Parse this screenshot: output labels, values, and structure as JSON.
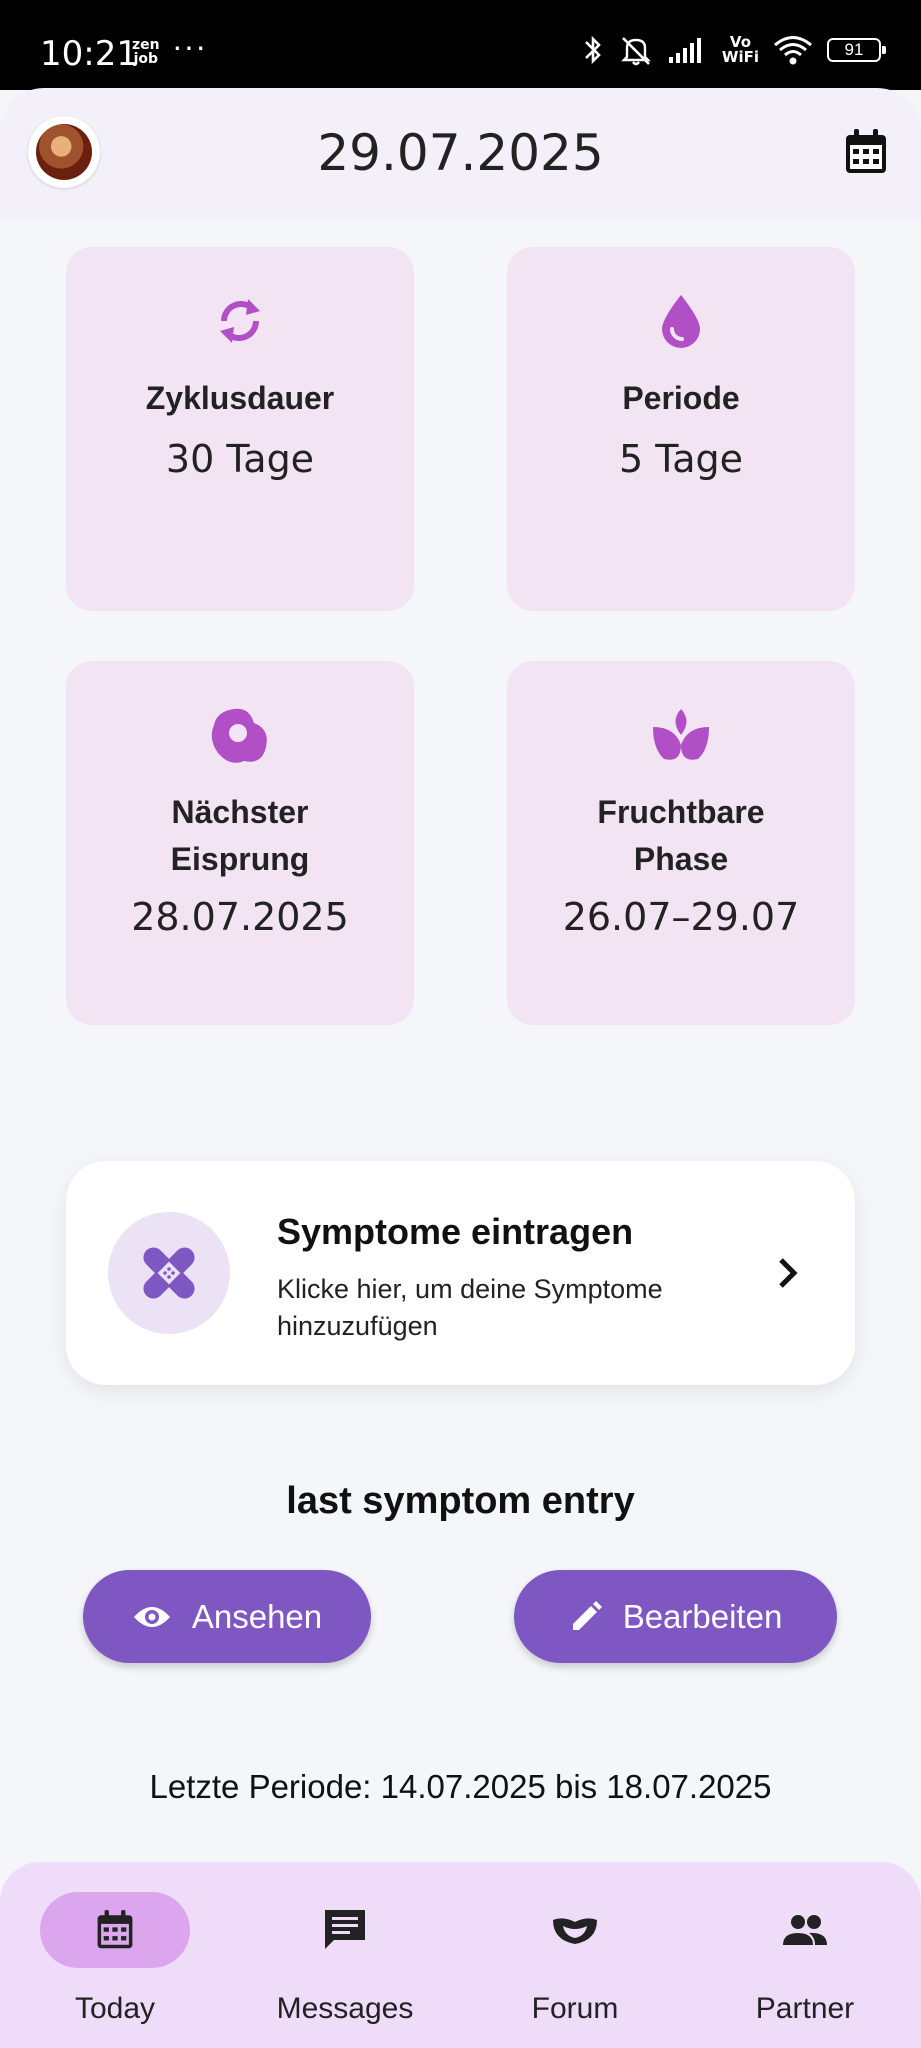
{
  "status_bar": {
    "time": "10:21",
    "app_badge_top": "zen",
    "app_badge_bottom": "job",
    "more": "···",
    "vowifi_top": "Vo",
    "vowifi_bottom": "WiFi",
    "battery": "91"
  },
  "header": {
    "date": "29.07.2025",
    "avatar_icon": "avatar-image",
    "calendar_icon": "calendar-icon"
  },
  "stats": [
    {
      "icon": "cycle-icon",
      "label": "Zyklusdauer",
      "value": "30 Tage"
    },
    {
      "icon": "drop-icon",
      "label": "Periode",
      "value": "5 Tage"
    },
    {
      "icon": "egg-icon",
      "label_line1": "Nächster",
      "label_line2": "Eisprung",
      "value": "28.07.2025"
    },
    {
      "icon": "lotus-icon",
      "label_line1": "Fruchtbare",
      "label_line2": "Phase",
      "value": "26.07–29.07"
    }
  ],
  "symptom_card": {
    "title": "Symptome eintragen",
    "subtitle": "Klicke hier, um deine Symptome hinzuzufügen",
    "icon": "bandage-icon"
  },
  "last_entry": {
    "title": "last symptom entry",
    "view_label": "Ansehen",
    "edit_label": "Bearbeiten"
  },
  "period_text": "Letzte Periode: 14.07.2025 bis 18.07.2025",
  "nav": [
    {
      "label": "Today",
      "icon": "calendar-icon",
      "active": true
    },
    {
      "label": "Messages",
      "icon": "message-icon",
      "active": false
    },
    {
      "label": "Forum",
      "icon": "mask-icon",
      "active": false
    },
    {
      "label": "Partner",
      "icon": "people-icon",
      "active": false
    }
  ],
  "colors": {
    "accent": "#7e57c2",
    "icon_accent": "#b04fc6",
    "card_bg": "#f3e4f3",
    "nav_bg": "#efdcf9",
    "nav_active": "#dba6ed"
  }
}
